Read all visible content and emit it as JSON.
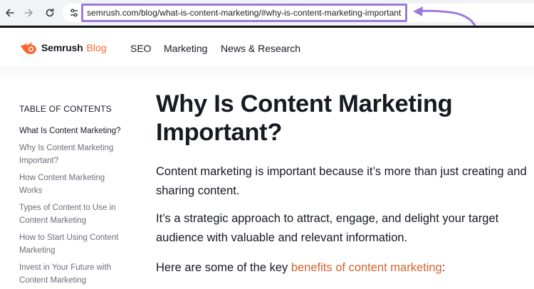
{
  "browser": {
    "url": "semrush.com/blog/what-is-content-marketing/#why-is-content-marketing-important",
    "icons": [
      "back-arrow-icon",
      "forward-arrow-icon",
      "reload-icon",
      "site-settings-icon"
    ]
  },
  "annotation": {
    "color": "#9b7ae0"
  },
  "header": {
    "brand": "Semrush",
    "brand_suffix": "Blog",
    "nav": [
      "SEO",
      "Marketing",
      "News & Research"
    ]
  },
  "toc": {
    "title": "TABLE OF CONTENTS",
    "items": [
      "What Is Content Marketing?",
      "Why Is Content Marketing Important?",
      "How Content Marketing Works",
      "Types of Content to Use in Content Marketing",
      "How to Start Using Content Marketing",
      "Invest in Your Future with Content Marketing"
    ]
  },
  "article": {
    "title": "Why Is Content Marketing Important?",
    "p1": "Content marketing is important because it’s more than just creating and sharing content.",
    "p2": "It’s a strategic approach to attract, engage, and delight your target audience with valuable and relevant information.",
    "p3_prefix": "Here are some of the key ",
    "p3_link": "benefits of content marketing",
    "p3_suffix": ":"
  },
  "colors": {
    "accent": "#ff642d",
    "link": "#d7632f",
    "text": "#171a22"
  }
}
